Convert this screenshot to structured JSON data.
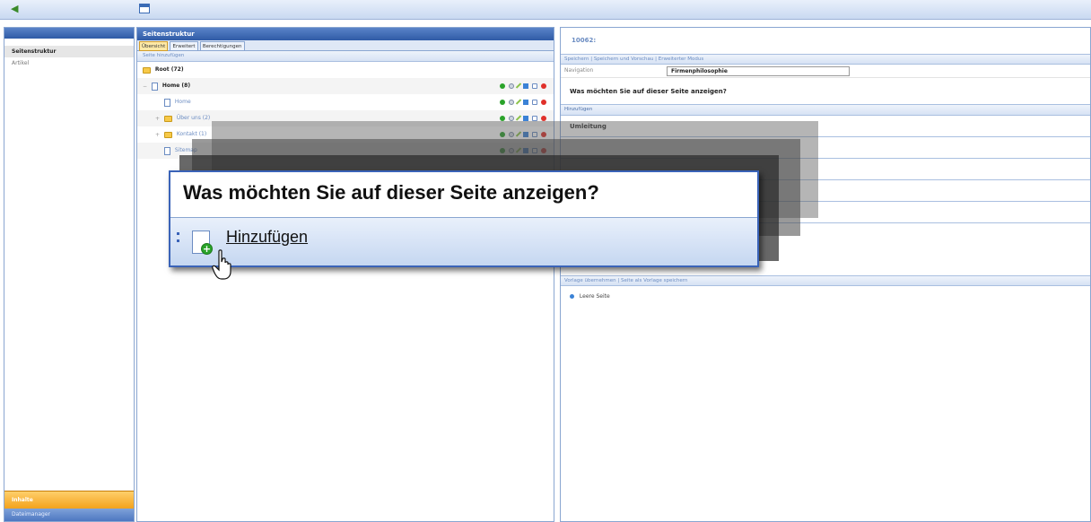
{
  "topbar": {
    "back_icon": "back-icon",
    "window_icon": "window-icon"
  },
  "leftnav": {
    "items": [
      {
        "label": "Seitenstruktur",
        "active": true
      },
      {
        "label": "Artikel",
        "active": false
      }
    ],
    "bottom_active": "Inhalte",
    "bottom_item": "Dateimanager"
  },
  "middle": {
    "title": "Seitenstruktur",
    "tabs": [
      "Übersicht",
      "Erweitert",
      "Berechtigungen"
    ],
    "toolbar_add": "Seite hinzufügen",
    "tree": [
      {
        "label": "Root (72)",
        "type": "root"
      },
      {
        "label": "Home (8)",
        "type": "folder-bold"
      },
      {
        "label": "Home",
        "type": "page"
      },
      {
        "label": "Über uns (2)",
        "type": "folder"
      },
      {
        "label": "Kontakt (1)",
        "type": "folder"
      },
      {
        "label": "Sitemap",
        "type": "page"
      }
    ]
  },
  "right": {
    "page_id": "10062:",
    "toolbar": {
      "save": "Speichern",
      "save_preview": "Speichern und Vorschau",
      "advanced": "Erweiterter Modus"
    },
    "navigation_label": "Navigation",
    "navigation_value": "Firmenphilosophie",
    "question": "Was möchten Sie auf dieser Seite anzeigen?",
    "add_label": "Hinzufügen",
    "block_redirect": "Umleitung",
    "bottom_toolbar": {
      "save_template": "Vorlage übernehmen",
      "save_as_template": "Seite als Vorlage speichern"
    },
    "option_empty": "Leere Seite"
  },
  "callout": {
    "title": "Was möchten Sie auf dieser Seite anzeigen?",
    "add_link": "Hinzufügen"
  },
  "colors": {
    "header_blue": "#2f5ba6",
    "active_orange": "#f3a21c",
    "link_blue": "#6b8cc2"
  }
}
